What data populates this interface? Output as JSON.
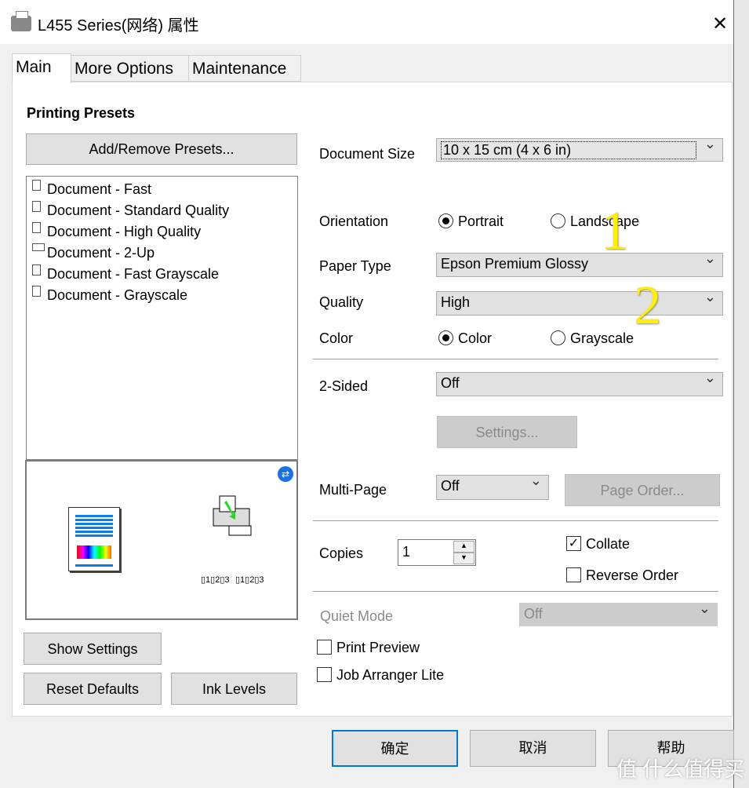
{
  "window": {
    "title": "L455 Series(网络) 属性",
    "close": "✕"
  },
  "tabs": [
    {
      "label": "Main",
      "active": true
    },
    {
      "label": "More Options"
    },
    {
      "label": "Maintenance"
    }
  ],
  "presets": {
    "heading": "Printing Presets",
    "add_remove": "Add/Remove Presets...",
    "items": [
      "Document - Fast",
      "Document - Standard Quality",
      "Document - High Quality",
      "Document - 2-Up",
      "Document - Fast Grayscale",
      "Document - Grayscale"
    ]
  },
  "left_buttons": {
    "show_settings": "Show Settings",
    "reset_defaults": "Reset Defaults",
    "ink_levels": "Ink Levels"
  },
  "settings": {
    "document_size": {
      "label": "Document Size",
      "value": "10 x 15 cm (4 x 6 in)"
    },
    "orientation": {
      "label": "Orientation",
      "portrait": "Portrait",
      "landscape": "Landscape",
      "selected": "Portrait"
    },
    "paper_type": {
      "label": "Paper Type",
      "value": "Epson Premium Glossy"
    },
    "quality": {
      "label": "Quality",
      "value": "High"
    },
    "color": {
      "label": "Color",
      "color": "Color",
      "grayscale": "Grayscale",
      "selected": "Color"
    },
    "two_sided": {
      "label": "2-Sided",
      "value": "Off",
      "settings_button": "Settings..."
    },
    "multi_page": {
      "label": "Multi-Page",
      "value": "Off",
      "page_order_button": "Page Order..."
    },
    "copies": {
      "label": "Copies",
      "value": "1"
    },
    "collate": {
      "label": "Collate",
      "checked": true
    },
    "reverse_order": {
      "label": "Reverse Order",
      "checked": false
    },
    "quiet_mode": {
      "label": "Quiet Mode",
      "value": "Off"
    },
    "print_preview": {
      "label": "Print Preview",
      "checked": false
    },
    "job_arranger": {
      "label": "Job Arranger Lite",
      "checked": false
    }
  },
  "footer": {
    "ok": "确定",
    "cancel": "取消",
    "help": "帮助"
  },
  "annotations": [
    "1",
    "2"
  ],
  "watermark": "值 什么值得买"
}
